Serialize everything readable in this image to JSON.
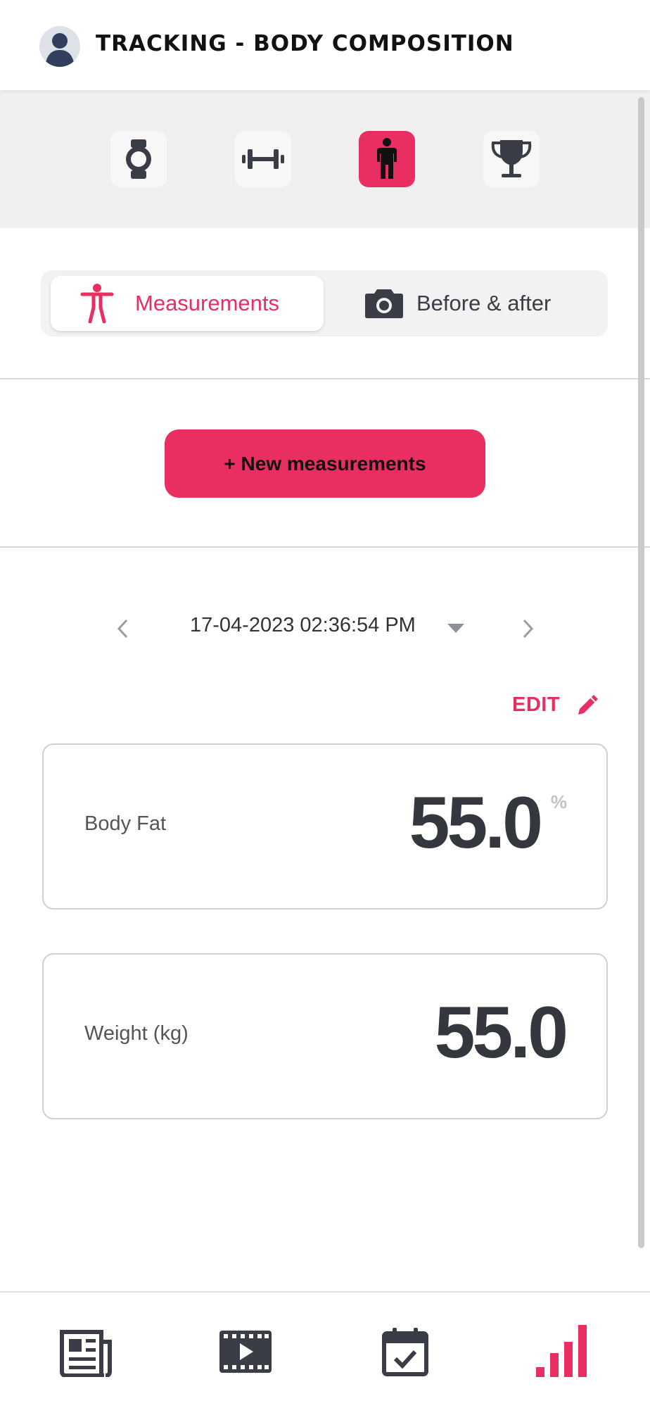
{
  "header": {
    "title": "TRACKING - BODY COMPOSITION",
    "avatar_icon": "user-silhouette-icon"
  },
  "categories": [
    {
      "icon": "watch-icon",
      "active": false
    },
    {
      "icon": "dumbbell-icon",
      "active": false
    },
    {
      "icon": "person-icon",
      "active": true
    },
    {
      "icon": "trophy-icon",
      "active": false
    }
  ],
  "segment": {
    "measurements": "Measurements",
    "before_after": "Before & after"
  },
  "new_button": {
    "label": "+ New measurements"
  },
  "date_nav": {
    "date": "17-04-2023 02:36:54 PM"
  },
  "edit": {
    "label": "EDIT"
  },
  "cards": [
    {
      "label": "Body Fat",
      "value": "55.0",
      "unit": "%"
    },
    {
      "label": "Weight (kg)",
      "value": "55.0"
    }
  ],
  "bottom_nav": [
    {
      "icon": "news-icon",
      "active": false
    },
    {
      "icon": "video-icon",
      "active": false
    },
    {
      "icon": "calendar-check-icon",
      "active": false
    },
    {
      "icon": "bar-chart-icon",
      "active": true
    }
  ],
  "colors": {
    "accent": "#e92e62",
    "text_dark": "#34373e",
    "strip_bg": "#f0f0f1"
  }
}
